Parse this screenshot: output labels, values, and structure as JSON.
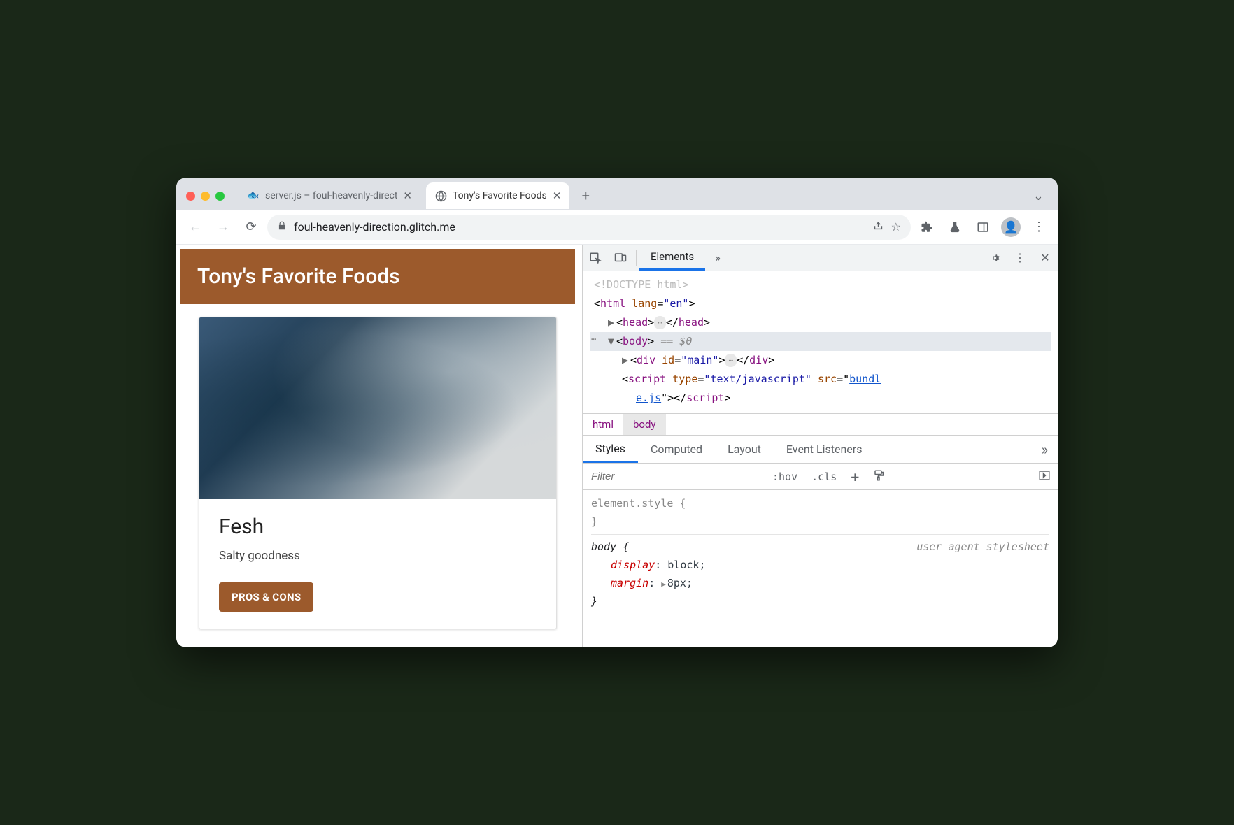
{
  "tabs": [
    {
      "label": "server.js – foul-heavenly-direct",
      "active": false
    },
    {
      "label": "Tony's Favorite Foods",
      "active": true
    }
  ],
  "omnibox": {
    "url": "foul-heavenly-direction.glitch.me"
  },
  "page": {
    "title": "Tony's Favorite Foods",
    "card": {
      "title": "Fesh",
      "desc": "Salty goodness",
      "button": "PROS & CONS"
    }
  },
  "devtools": {
    "main_tab": "Elements",
    "dom": {
      "doctype": "<!DOCTYPE html>",
      "html_open": "html",
      "html_lang_attr": "lang",
      "html_lang_val": "\"en\"",
      "head": "head",
      "body": "body",
      "body_marker": "== $0",
      "div_tag": "div",
      "div_id_attr": "id",
      "div_id_val": "\"main\"",
      "script_tag": "script",
      "script_type_attr": "type",
      "script_type_val": "\"text/javascript\"",
      "script_src_attr": "src",
      "script_src_val1": "bundl",
      "script_src_val2": "e.js"
    },
    "breadcrumb": [
      "html",
      "body"
    ],
    "styles_tabs": [
      "Styles",
      "Computed",
      "Layout",
      "Event Listeners"
    ],
    "filter_placeholder": "Filter",
    "filter_buttons": {
      "hov": ":hov",
      "cls": ".cls",
      "plus": "+"
    },
    "rules": {
      "element_style_sel": "element.style {",
      "body_sel": "body {",
      "body_src": "user agent stylesheet",
      "p_display": "display",
      "v_display": "block",
      "p_margin": "margin",
      "v_margin": "8px"
    }
  }
}
